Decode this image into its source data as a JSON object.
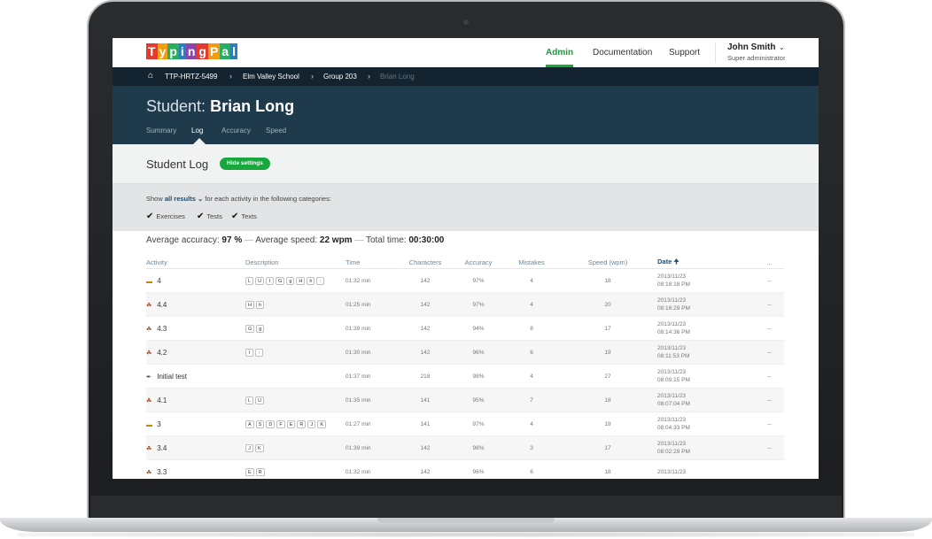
{
  "logo": {
    "text": "TypingPal"
  },
  "topnav": [
    {
      "label": "Admin"
    },
    {
      "label": "Documentation"
    },
    {
      "label": "Support"
    }
  ],
  "user": {
    "name": "John Smith",
    "role": "Super administrator"
  },
  "breadcrumb": [
    "TTP-HRTZ-5499",
    "Elm Valley School",
    "Group 203",
    "Brian Long"
  ],
  "student": {
    "prefix": "Student:",
    "name": "Brian Long"
  },
  "subtabs": [
    "Summary",
    "Log",
    "Accuracy",
    "Speed"
  ],
  "page": {
    "title": "Student Log",
    "hide_settings": "Hide settings"
  },
  "filters": {
    "show": "Show",
    "mode": "all results",
    "rest": "for each activity in the following categories:",
    "categories": [
      "Exercises",
      "Tests",
      "Texts"
    ]
  },
  "summary": {
    "accuracy_label": "Average accuracy:",
    "accuracy": "97 %",
    "speed_label": "Average speed:",
    "speed": "22 wpm",
    "time_label": "Total time:",
    "time": "00:30:00"
  },
  "table": {
    "headers": [
      "Activity",
      "Description",
      "Time",
      "Characters",
      "Accuracy",
      "Mistakes",
      "Speed (wpm)",
      "Date",
      "..."
    ],
    "rows": [
      {
        "icon": "hat-icon",
        "activity": "4",
        "keys": [
          "L",
          "U",
          "I",
          "G",
          "g",
          "H",
          "h",
          ":"
        ],
        "time": "01:32 min",
        "chars": "142",
        "acc": "97%",
        "mist": "4",
        "speed": "18",
        "date": "2013/11/23",
        "clock": "08:18:18 PM",
        "more": "--"
      },
      {
        "icon": "figure-icon",
        "activity": "4.4",
        "keys": [
          "H",
          "h"
        ],
        "time": "01:25 min",
        "chars": "142",
        "acc": "97%",
        "mist": "4",
        "speed": "20",
        "date": "2013/11/23",
        "clock": "08:16:29 PM",
        "more": "--"
      },
      {
        "icon": "figure-icon",
        "activity": "4.3",
        "keys": [
          "G",
          "g"
        ],
        "time": "01:39 min",
        "chars": "142",
        "acc": "94%",
        "mist": "8",
        "speed": "17",
        "date": "2013/11/23",
        "clock": "08:14:36 PM",
        "more": "--"
      },
      {
        "icon": "figure-icon",
        "activity": "4.2",
        "keys": [
          "I",
          ":"
        ],
        "time": "01:30 min",
        "chars": "142",
        "acc": "96%",
        "mist": "6",
        "speed": "19",
        "date": "2013/11/23",
        "clock": "08:11:53 PM",
        "more": "--"
      },
      {
        "icon": "test-icon",
        "activity": "Initial test",
        "keys": [],
        "time": "01:37 min",
        "chars": "218",
        "acc": "98%",
        "mist": "4",
        "speed": "27",
        "date": "2013/11/23",
        "clock": "08:09:15 PM",
        "more": "--"
      },
      {
        "icon": "figure-icon",
        "activity": "4.1",
        "keys": [
          "L",
          "U"
        ],
        "time": "01:35 min",
        "chars": "141",
        "acc": "95%",
        "mist": "7",
        "speed": "18",
        "date": "2013/11/23",
        "clock": "08:07:04 PM",
        "more": "--"
      },
      {
        "icon": "hat-icon",
        "activity": "3",
        "keys": [
          "A",
          "S",
          "D",
          "F",
          "E",
          "R",
          "J",
          "K"
        ],
        "time": "01:27 min",
        "chars": "141",
        "acc": "97%",
        "mist": "4",
        "speed": "19",
        "date": "2013/11/23",
        "clock": "08:04:33 PM",
        "more": "--"
      },
      {
        "icon": "figure-icon",
        "activity": "3.4",
        "keys": [
          "J",
          "K"
        ],
        "time": "01:39 min",
        "chars": "142",
        "acc": "98%",
        "mist": "3",
        "speed": "17",
        "date": "2013/11/23",
        "clock": "08:02:29 PM",
        "more": "--"
      },
      {
        "icon": "figure-icon",
        "activity": "3.3",
        "keys": [
          "E",
          "R"
        ],
        "time": "01:32 min",
        "chars": "142",
        "acc": "96%",
        "mist": "6",
        "speed": "18",
        "date": "2013/11/23",
        "clock": "",
        "more": ""
      }
    ]
  }
}
